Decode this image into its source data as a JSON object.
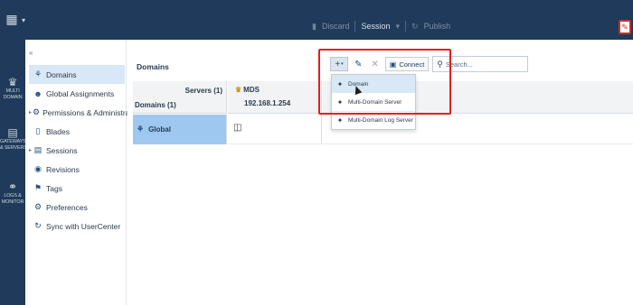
{
  "topbar": {
    "session_label": "Session",
    "publish_label": "Publish",
    "discard_label": "Discard"
  },
  "rail": {
    "items": [
      {
        "label1": "MULTI",
        "label2": "DOMAIN",
        "icon": "crown-icon"
      },
      {
        "label1": "GATEWAYS",
        "label2": "& SERVERS",
        "icon": "server-icon"
      },
      {
        "label1": "LOGS &",
        "label2": "MONITOR",
        "icon": "gauge-icon"
      }
    ]
  },
  "sidebar": {
    "items": [
      {
        "label": "Domains",
        "icon": "domains-icon",
        "active": true
      },
      {
        "label": "Global Assignments",
        "icon": "user-icon"
      },
      {
        "label": "Permissions & Administrators",
        "icon": "gear-icon",
        "expandable": true
      },
      {
        "label": "Blades",
        "icon": "blades-icon"
      },
      {
        "label": "Sessions",
        "icon": "sessions-icon",
        "expandable": true
      },
      {
        "label": "Revisions",
        "icon": "revisions-icon"
      },
      {
        "label": "Tags",
        "icon": "tag-icon"
      },
      {
        "label": "Preferences",
        "icon": "preferences-icon"
      },
      {
        "label": "Sync with UserCenter",
        "icon": "sync-icon"
      }
    ]
  },
  "main": {
    "title": "Domains",
    "toolbar": {
      "connect_label": "Connect",
      "search_placeholder": "Search..."
    },
    "grid": {
      "servers_header": "Servers (1)",
      "domains_header": "Domains (1)",
      "server": {
        "name": "MDS",
        "ip": "192.168.1.254"
      },
      "rows": [
        {
          "label": "Global"
        }
      ]
    },
    "menu": {
      "items": [
        {
          "label": "Domain"
        },
        {
          "label": "Multi-Domain Server"
        },
        {
          "label": "Multi-Domain Log Server"
        }
      ]
    }
  },
  "colors": {
    "nav_dark": "#1f3a5a",
    "selected_row": "#9ec8f0",
    "highlight": "#e02020"
  }
}
